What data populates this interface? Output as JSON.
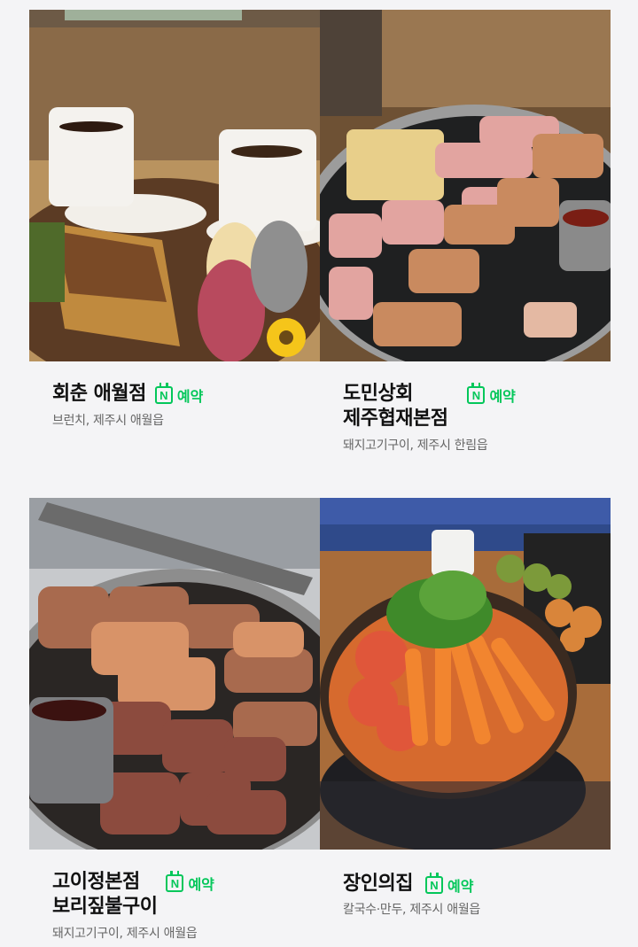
{
  "restaurants": [
    {
      "name": "회춘 애월점",
      "reserve": "N",
      "reserve_label": "예약",
      "desc": "브런치, 제주시 애월읍"
    },
    {
      "name": "도민상회\n제주협재본점",
      "reserve": "N",
      "reserve_label": "예약",
      "desc": "돼지고기구이, 제주시 한림읍"
    },
    {
      "name": "고이정본점\n보리짚불구이",
      "reserve": "N",
      "reserve_label": "예약",
      "desc": "돼지고기구이, 제주시 애월읍"
    },
    {
      "name": "장인의집",
      "reserve": "N",
      "reserve_label": "예약",
      "desc": "칼국수·만두, 제주시 애월읍"
    }
  ],
  "colors": {
    "accent": "#03c75a",
    "background": "#f4f4f6"
  },
  "icons": {
    "reserve": "naver-booking-icon"
  }
}
